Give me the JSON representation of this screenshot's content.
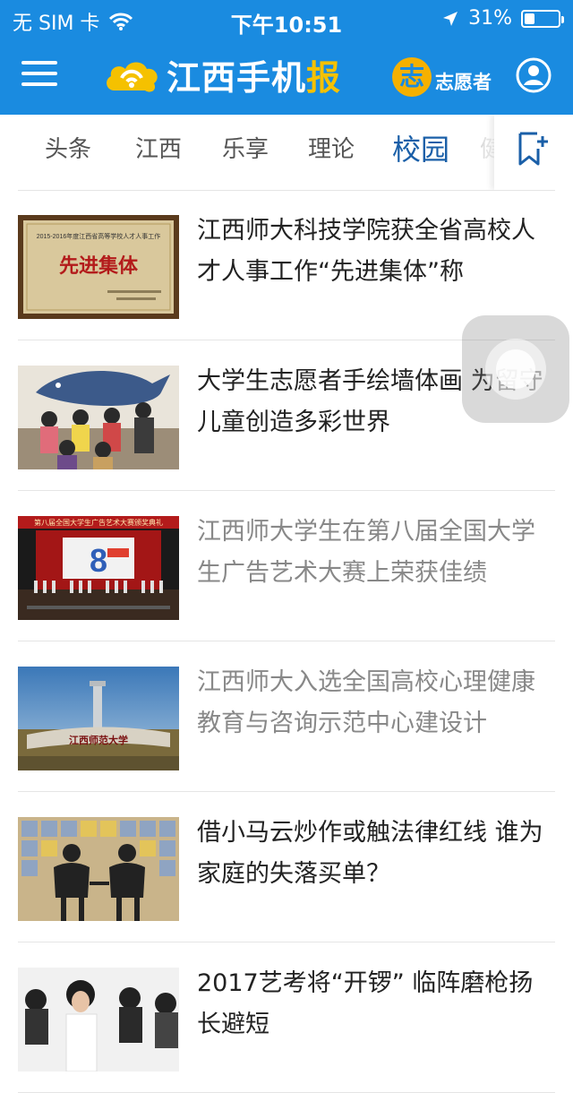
{
  "status_bar": {
    "carrier": "无 SIM 卡",
    "time": "下午10:51",
    "battery": "31%",
    "battery_level": 0.31
  },
  "app": {
    "title_main": "江西手机",
    "title_accent": "报",
    "volunteer_label": "志愿者",
    "volunteer_badge": "志"
  },
  "tabs": [
    {
      "label": "头条"
    },
    {
      "label": "江西"
    },
    {
      "label": "乐享"
    },
    {
      "label": "理论"
    },
    {
      "label": "校园",
      "active": true
    },
    {
      "label": "健"
    }
  ],
  "news": [
    {
      "title": "江西师大科技学院获全省高校人才人事工作“先进集体”称",
      "read": false,
      "thumb": {
        "year": "2015-2016年度江西省高等学校人才人事工作",
        "award": "先进集体"
      }
    },
    {
      "title": "大学生志愿者手绘墙体画 为留守儿童创造多彩世界",
      "read": false
    },
    {
      "title": "江西师大学生在第八届全国大学生广告艺术大赛上荣获佳绩",
      "read": true,
      "thumb": {
        "banner": "第八届全国大学生广告艺术大赛颁奖典礼",
        "screen": "8"
      }
    },
    {
      "title": "江西师大入选全国高校心理健康教育与咨询示范中心建设计",
      "read": true,
      "thumb": {
        "sign": "江西师范大学"
      }
    },
    {
      "title": "借小马云炒作或触法律红线 谁为家庭的失落买单？",
      "read": false
    },
    {
      "title": "2017艺考将“开锣” 临阵磨枪扬长避短",
      "read": false
    }
  ],
  "colors": {
    "brand_blue": "#1a8be0",
    "accent_yellow": "#f5c100",
    "active_tab": "#1a5fa8"
  }
}
